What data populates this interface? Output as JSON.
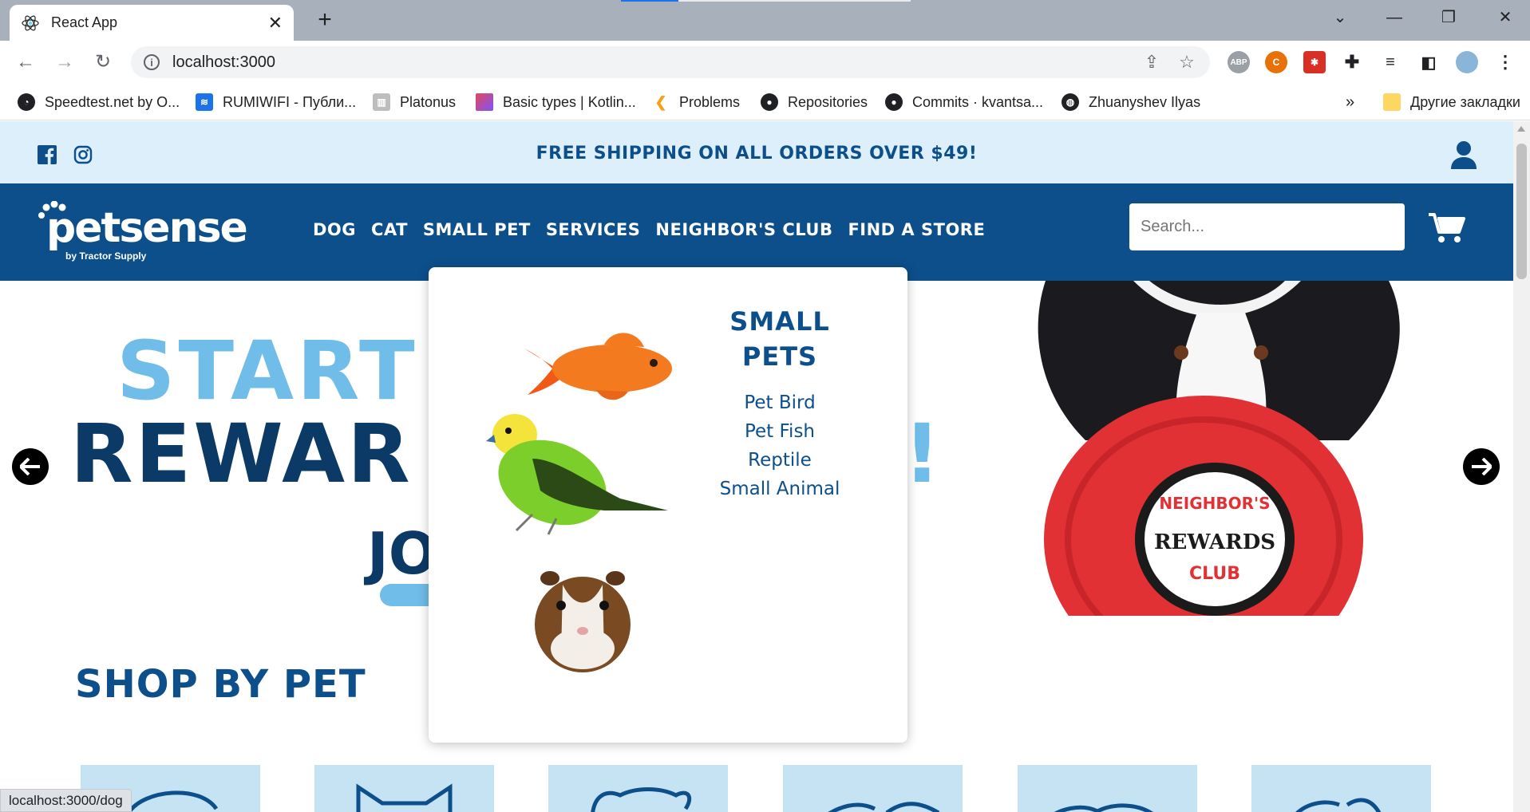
{
  "browser": {
    "tab_title": "React App",
    "url": "localhost:3000",
    "status_url": "localhost:3000/dog",
    "bookmarks": [
      {
        "label": "Speedtest.net by O...",
        "icon": "speedtest-icon",
        "color": "#202124"
      },
      {
        "label": "RUMIWIFI - Публи...",
        "icon": "wifi-icon",
        "color": "#1a73e8"
      },
      {
        "label": "Platonus",
        "icon": "platonus-icon",
        "color": "#9e9e9e"
      },
      {
        "label": "Basic types | Kotlin...",
        "icon": "kotlin-icon",
        "color": "#7f52ff"
      },
      {
        "label": "Problems",
        "icon": "leetcode-icon",
        "color": "#f89f1b"
      },
      {
        "label": "Repositories",
        "icon": "github-icon",
        "color": "#202124"
      },
      {
        "label": "Commits · kvantsa...",
        "icon": "github-icon",
        "color": "#202124"
      },
      {
        "label": "Zhuanyshev Ilyas",
        "icon": "globe-icon",
        "color": "#202124"
      }
    ],
    "other_bookmarks": "Другие закладки",
    "overflow": "»"
  },
  "site": {
    "promo": "FREE SHIPPING ON ALL ORDERS OVER $49!",
    "logo_text": "petsense",
    "logo_sub": "by Tractor Supply",
    "menu": [
      "DOG",
      "CAT",
      "SMALL PET",
      "SERVICES",
      "NEIGHBOR'S CLUB",
      "FIND A STORE"
    ],
    "search_placeholder": "Search...",
    "hero": {
      "line1": "START",
      "line2": "REWAR",
      "line2_end": "!",
      "line3": "JO",
      "badge_top": "NEIGHBOR'S",
      "badge_mid": "REWARDS",
      "badge_bottom": "CLUB"
    },
    "shop_title": "SHOP BY PET",
    "dropdown": {
      "title": "SMALL PETS",
      "links": [
        "Pet Bird",
        "Pet Fish",
        "Reptile",
        "Small Animal"
      ]
    }
  },
  "colors": {
    "brand_blue": "#0d4f8b",
    "light_blue": "#ddeffa",
    "tile_blue": "#c6e3f4",
    "hero_light": "#6fbde8",
    "hero_dark": "#0b3a66"
  }
}
